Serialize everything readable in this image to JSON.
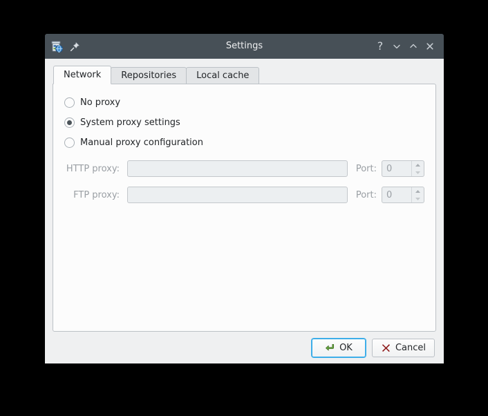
{
  "window": {
    "title": "Settings",
    "icon": "package-manager-icon",
    "pin_icon": "pin-icon",
    "controls": [
      {
        "name": "help-button",
        "label": "?"
      },
      {
        "name": "minimize-button",
        "label": ""
      },
      {
        "name": "maximize-button",
        "label": ""
      },
      {
        "name": "close-button",
        "label": ""
      }
    ]
  },
  "tabs": [
    {
      "label": "Network",
      "active": true
    },
    {
      "label": "Repositories",
      "active": false
    },
    {
      "label": "Local cache",
      "active": false
    }
  ],
  "network": {
    "proxy_mode_options": [
      {
        "label": "No proxy",
        "selected": false
      },
      {
        "label": "System proxy settings",
        "selected": true
      },
      {
        "label": "Manual proxy configuration",
        "selected": false
      }
    ],
    "fields": [
      {
        "label": "HTTP proxy:",
        "value": "",
        "placeholder": "",
        "port_label": "Port:",
        "port_value": "0",
        "disabled": true
      },
      {
        "label": "FTP proxy:",
        "value": "",
        "placeholder": "",
        "port_label": "Port:",
        "port_value": "0",
        "disabled": true
      }
    ]
  },
  "footer": {
    "ok_label": "OK",
    "cancel_label": "Cancel"
  },
  "colors": {
    "titlebar": "#475057",
    "dialog_bg": "#eff0f1",
    "panel_bg": "#fcfcfc",
    "focus_accent": "#3daee9",
    "ok_icon": "#54a33b",
    "cancel_icon": "#8e1a1a",
    "text": "#232629",
    "disabled_text": "#9a9fa4"
  }
}
